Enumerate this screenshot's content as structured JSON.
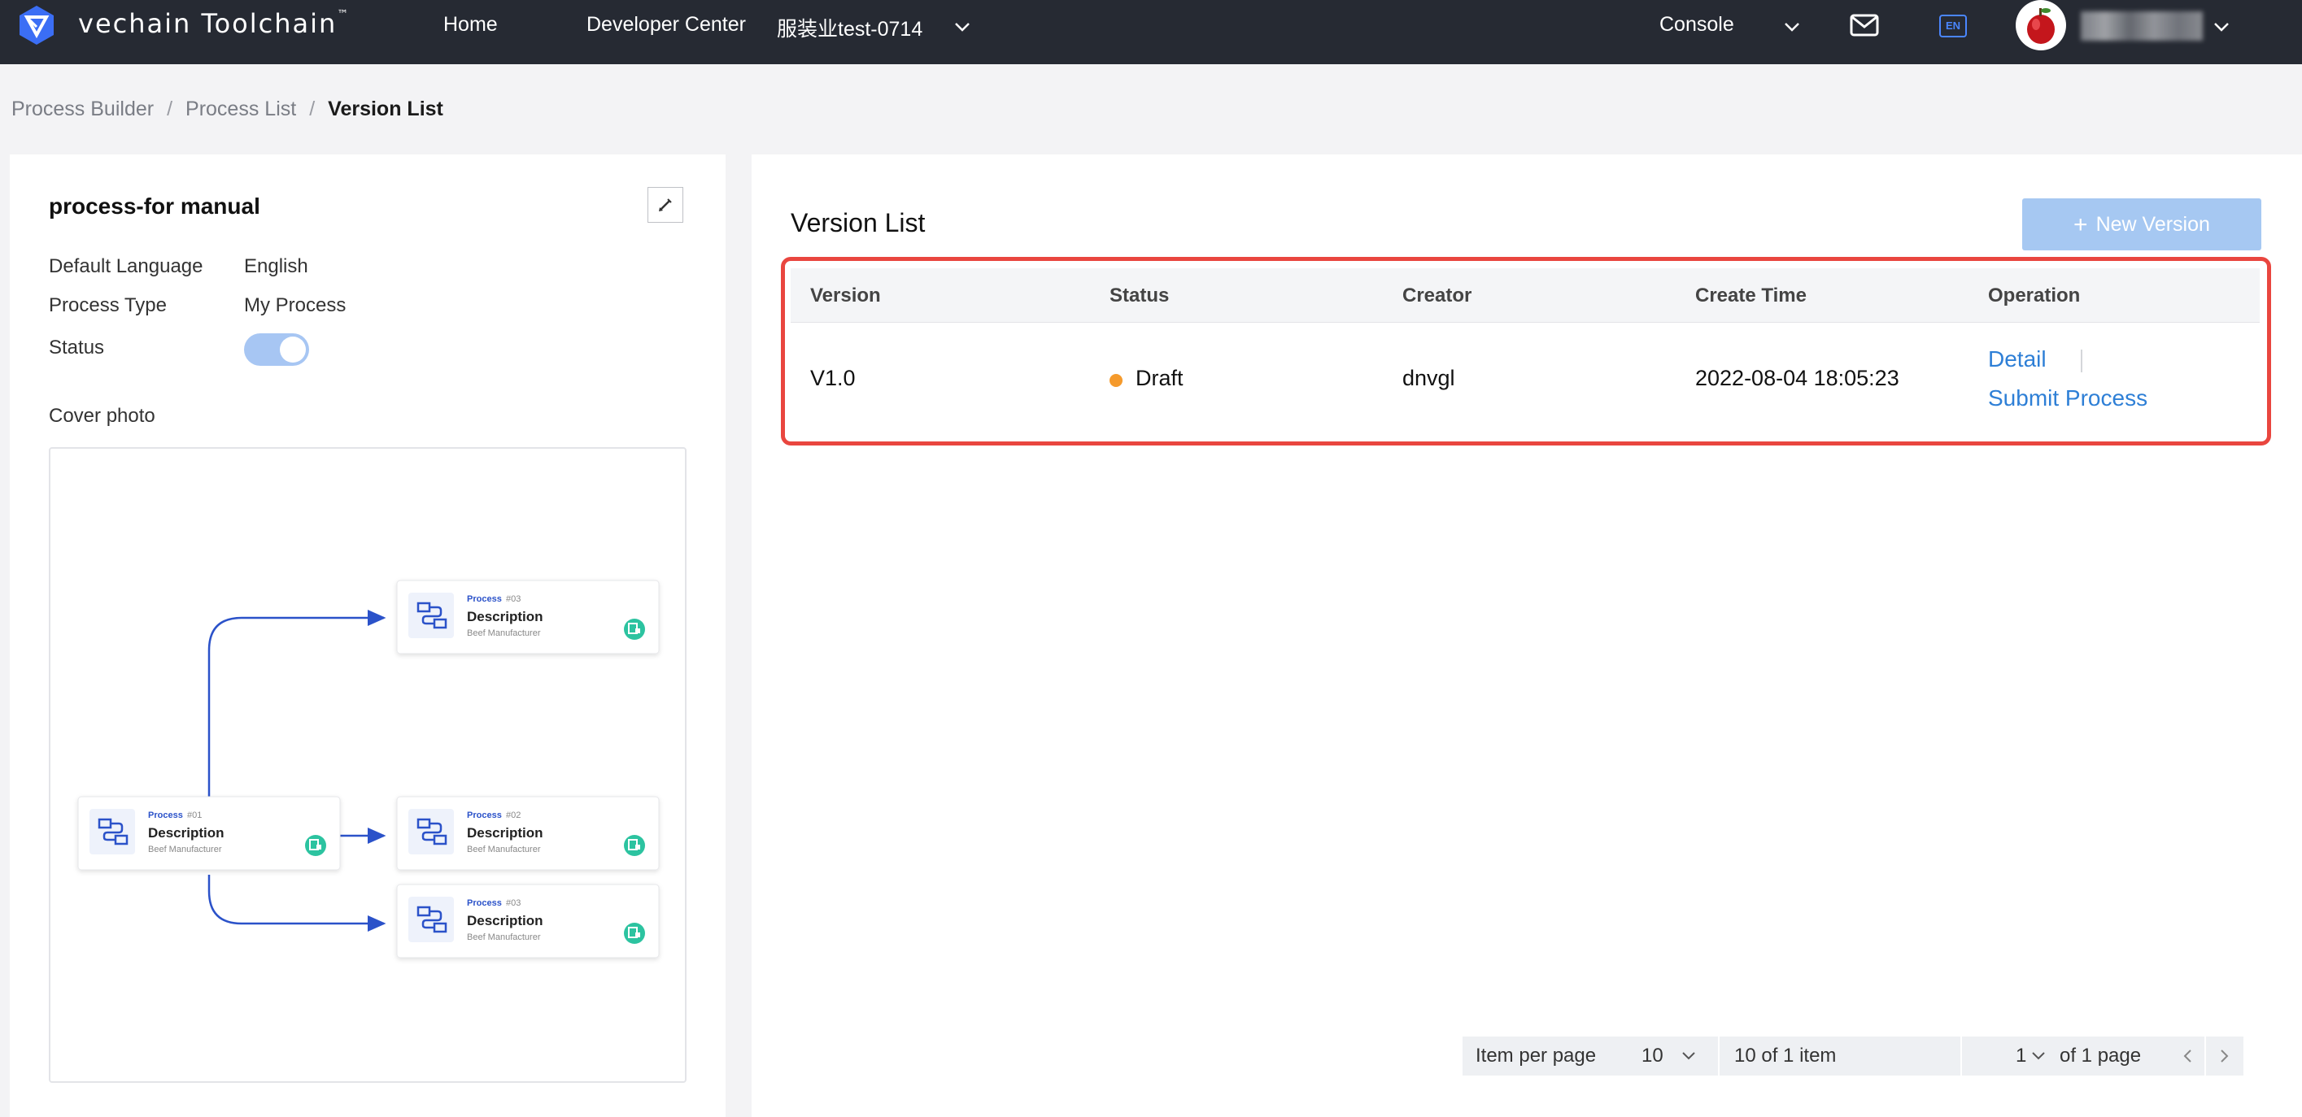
{
  "topbar": {
    "brand": "vechain Toolchain",
    "brand_tm": "™",
    "nav": {
      "home": "Home",
      "developer_center": "Developer Center",
      "org_selector": "服装业test-0714",
      "console": "Console"
    },
    "lang_badge": "EN",
    "icons": [
      "vechain-logo-icon",
      "chevron-down-icon",
      "mail-icon",
      "language-icon",
      "avatar",
      "chevron-down-icon"
    ]
  },
  "breadcrumb": {
    "items": [
      "Process Builder",
      "Process List",
      "Version List"
    ],
    "separator": "/"
  },
  "process": {
    "title": "process-for manual",
    "default_language_label": "Default Language",
    "default_language_value": "English",
    "process_type_label": "Process Type",
    "process_type_value": "My Process",
    "status_label": "Status",
    "status_enabled": true,
    "cover_label": "Cover photo"
  },
  "cover_diagram": {
    "nodes": [
      {
        "tag": "Process",
        "num": "#01",
        "title": "Description",
        "sub": "Beef Manufacturer"
      },
      {
        "tag": "Process",
        "num": "#03",
        "title": "Description",
        "sub": "Beef Manufacturer"
      },
      {
        "tag": "Process",
        "num": "#02",
        "title": "Description",
        "sub": "Beef Manufacturer"
      },
      {
        "tag": "Process",
        "num": "#03",
        "title": "Description",
        "sub": "Beef Manufacturer"
      }
    ]
  },
  "version_list": {
    "title": "Version List",
    "new_version_label": "New Version",
    "columns": [
      "Version",
      "Status",
      "Creator",
      "Create Time",
      "Operation"
    ],
    "rows": [
      {
        "version": "V1.0",
        "status": "Draft",
        "status_color": "#f59a2c",
        "creator": "dnvgl",
        "create_time": "2022-08-04 18:05:23",
        "operations": [
          "Detail",
          "Submit Process"
        ]
      }
    ]
  },
  "pagination": {
    "item_per_page_label": "Item per page",
    "page_size": "10",
    "range_text": "10 of 1 item",
    "current_page": "1",
    "of_pages_text": "of 1 page"
  },
  "colors": {
    "topbar_bg": "#262a33",
    "accent": "#2e7fd6",
    "highlight": "#e9463f",
    "draft": "#f59a2c"
  }
}
